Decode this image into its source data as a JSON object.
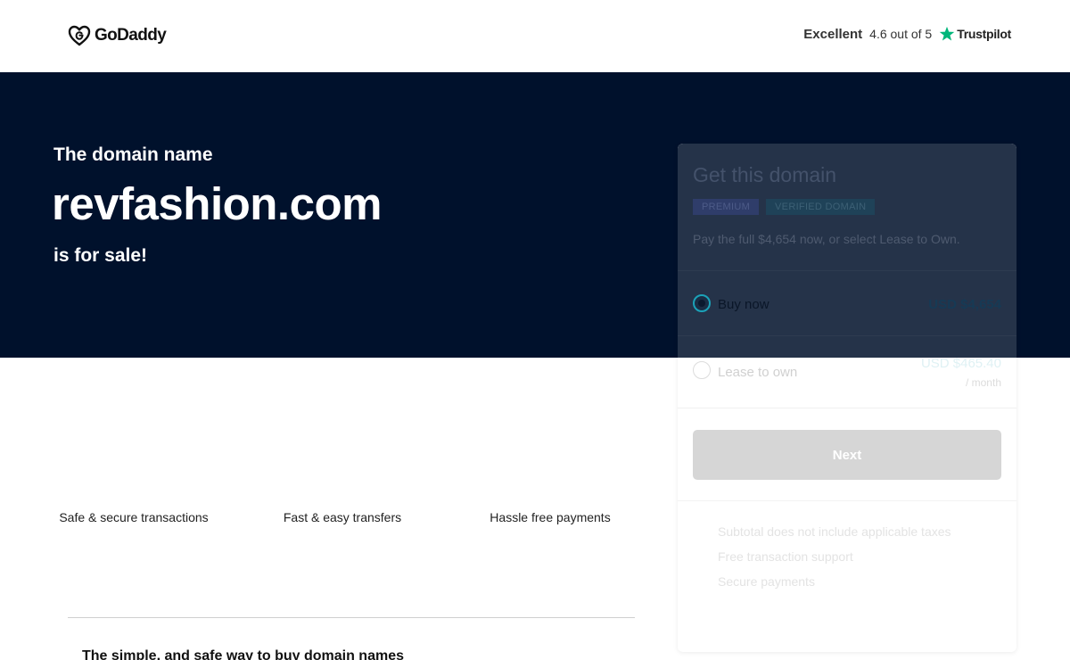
{
  "header": {
    "brand": "GoDaddy",
    "rating_word": "Excellent",
    "rating_score": "4.6 out of 5",
    "rating_brand": "Trustpilot"
  },
  "hero": {
    "intro": "The domain name",
    "domain": "revfashion.com",
    "outro": "is for sale!"
  },
  "features": [
    {
      "label": "Safe & secure transactions"
    },
    {
      "label": "Fast & easy transfers"
    },
    {
      "label": "Hassle free payments"
    }
  ],
  "tagline": "The simple, and safe way to buy domain names",
  "card": {
    "title": "Get this domain",
    "badges": [
      "PREMIUM",
      "VERIFIED DOMAIN"
    ],
    "description": "Pay the full $4,654 now, or select Lease to Own.",
    "options": [
      {
        "label": "Buy now",
        "price": "USD $4,654",
        "selected": true
      },
      {
        "label": "Lease to own",
        "price": "USD $465.40",
        "sub": "/ month",
        "selected": false
      }
    ],
    "next_label": "Next",
    "perks": [
      "Subtotal does not include applicable taxes",
      "Free transaction support",
      "Secure payments"
    ]
  },
  "colors": {
    "hero_bg": "#00112c",
    "trustpilot_green": "#00b67a",
    "accent_teal": "#1ba2b8"
  }
}
